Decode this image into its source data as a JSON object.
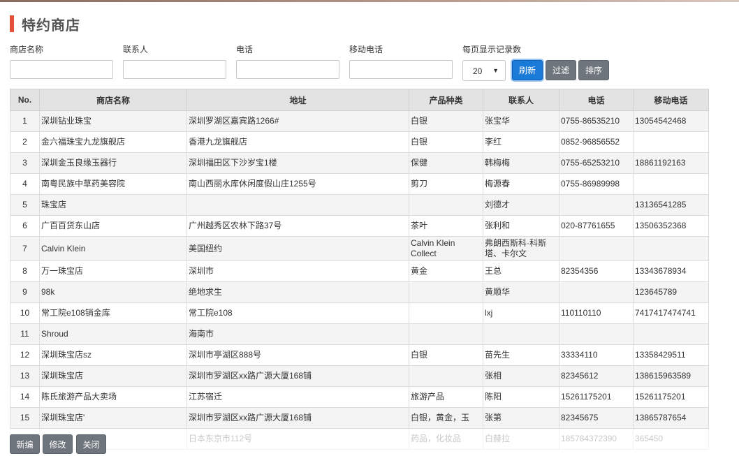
{
  "page": {
    "title": "特约商店"
  },
  "filters": {
    "store_name_label": "商店名称",
    "contact_label": "联系人",
    "phone_label": "电话",
    "mobile_label": "移动电话",
    "page_size_label": "每页显示记录数",
    "store_name_value": "",
    "contact_value": "",
    "phone_value": "",
    "mobile_value": "",
    "page_size_value": "20"
  },
  "toolbar": {
    "refresh": "刷新",
    "filter": "过滤",
    "sort": "排序"
  },
  "table": {
    "columns": [
      "No.",
      "商店名称",
      "地址",
      "产品种类",
      "联系人",
      "电话",
      "移动电话"
    ],
    "rows": [
      [
        "1",
        "深圳钻业珠宝",
        "深圳罗湖区嘉宾路1266#",
        "白银",
        "张宝华",
        "0755-86535210",
        "13054542468"
      ],
      [
        "2",
        "金六福珠宝九龙旗舰店",
        "香港九龙旗舰店",
        "白银",
        "李红",
        "0852-96856552",
        ""
      ],
      [
        "3",
        "深圳金玉良缘玉器行",
        "深圳福田区下沙岁宝1楼",
        "保健",
        "韩梅梅",
        "0755-65253210",
        "18861192163"
      ],
      [
        "4",
        "南粤民族中草药美容院",
        "南山西丽水库休闲度假山庄1255号",
        "剪刀",
        "梅源春",
        "0755-86989998",
        ""
      ],
      [
        "5",
        "珠宝店",
        "",
        "",
        "刘德才",
        "",
        "13136541285"
      ],
      [
        "6",
        "广百百货东山店",
        "广州越秀区农林下路37号",
        "茶叶",
        "张利和",
        "020-87761655",
        "13506352368"
      ],
      [
        "7",
        "Calvin Klein",
        "美国纽约",
        "Calvin Klein Collect",
        "弗朗西斯科·科斯塔、卡尔文",
        "",
        ""
      ],
      [
        "8",
        "万一珠宝店",
        "深圳市",
        "黄金",
        "王总",
        "82354356",
        "13343678934"
      ],
      [
        "9",
        "98k",
        "绝地求生",
        "",
        "黄顺华",
        "",
        "123645789"
      ],
      [
        "10",
        "常工院e108销金库",
        "常工院e108",
        "",
        "lxj",
        "110110110",
        "7417417474741"
      ],
      [
        "11",
        "Shroud",
        "海南市",
        "",
        "",
        "",
        ""
      ],
      [
        "12",
        "深圳珠宝店sz",
        "深圳市亭湖区888号",
        "白银",
        "苗先生",
        "33334110",
        "13358429511"
      ],
      [
        "13",
        "深圳珠宝店",
        "深圳市罗湖区xx路广源大厦168铺",
        "",
        "张相",
        "82345612",
        "138615963589"
      ],
      [
        "14",
        "陈氏旅游产品大卖场",
        "江苏宿迁",
        "旅游产品",
        "陈阳",
        "15261175201",
        "15261175201"
      ],
      [
        "15",
        "深圳珠宝店'",
        "深圳市罗湖区xx路广源大厦168铺",
        "白银，黄金，玉",
        "张第",
        "82345675",
        "13865787654"
      ],
      [
        "16",
        "",
        "日本东京市112号",
        "药品，化妆品",
        "白赫拉",
        "185784372390",
        "365450"
      ]
    ]
  },
  "actions": {
    "new": "新编",
    "edit": "修改",
    "close": "关闭"
  }
}
